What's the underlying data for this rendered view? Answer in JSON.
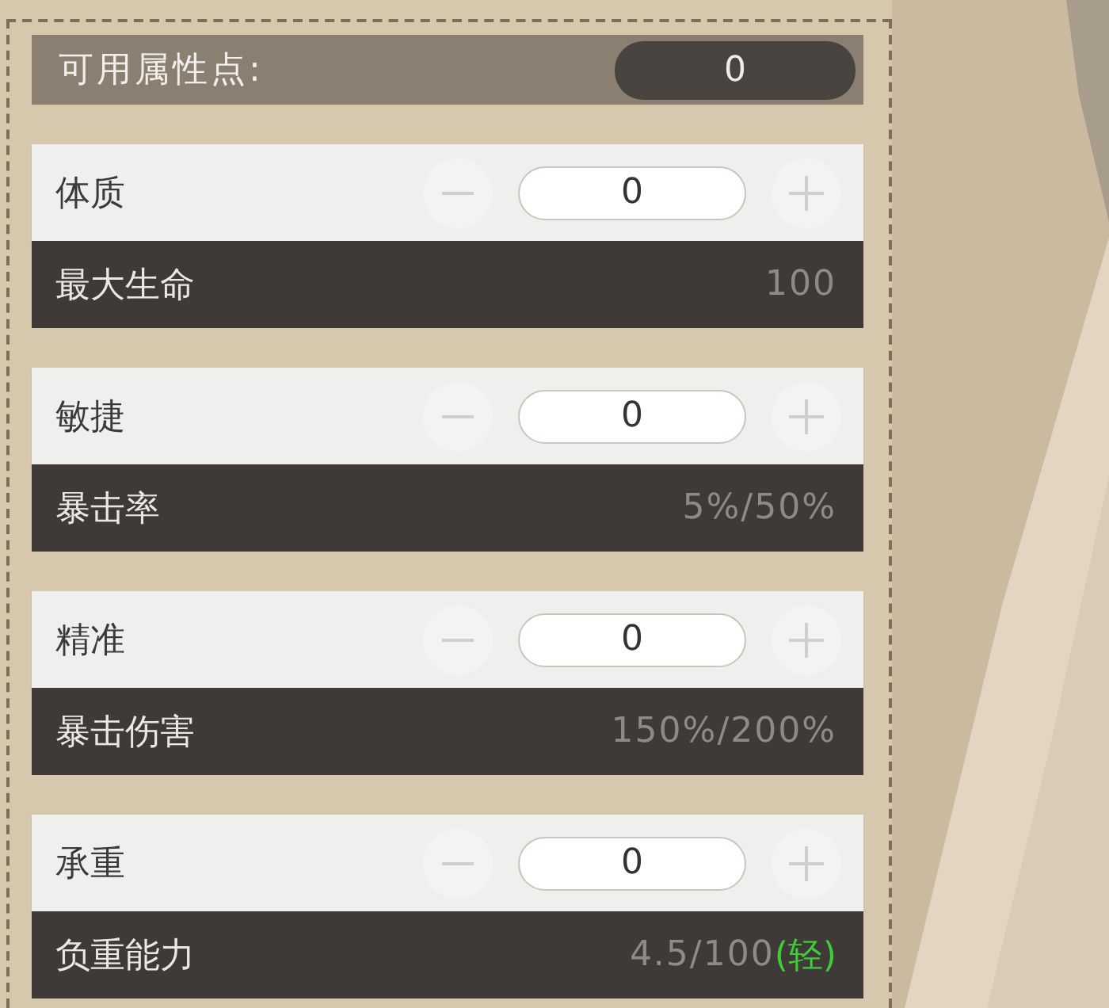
{
  "points": {
    "label": "可用属性点:",
    "value": "0"
  },
  "attributes": [
    {
      "name": "体质",
      "value": "0",
      "decrease": {
        "disabled": true
      },
      "increase": {
        "disabled": true
      },
      "stat": {
        "label": "最大生命",
        "value": "100"
      }
    },
    {
      "name": "敏捷",
      "value": "0",
      "decrease": {
        "disabled": true
      },
      "increase": {
        "disabled": true
      },
      "stat": {
        "label": "暴击率",
        "value": "5%/50%"
      }
    },
    {
      "name": "精准",
      "value": "0",
      "decrease": {
        "disabled": true
      },
      "increase": {
        "disabled": true
      },
      "stat": {
        "label": "暴击伤害",
        "value": "150%/200%"
      }
    },
    {
      "name": "承重",
      "value": "0",
      "decrease": {
        "disabled": true
      },
      "increase": {
        "disabled": true
      },
      "stat": {
        "label": "负重能力",
        "value": "4.5/100",
        "tag": "(轻)"
      }
    }
  ]
}
